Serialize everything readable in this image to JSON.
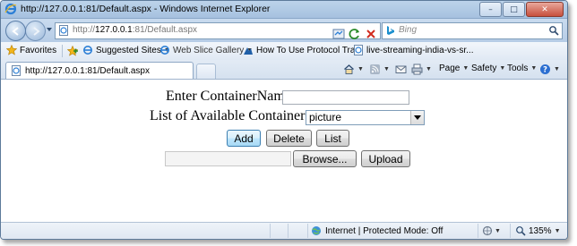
{
  "window": {
    "title": "http://127.0.0.1:81/Default.aspx - Windows Internet Explorer",
    "controls": {
      "minimize": "–",
      "maximize": "□",
      "close": "✕"
    }
  },
  "address_bar": {
    "url_prefix": "http://",
    "url_host": "127.0.0.1",
    "url_rest": ":81/Default.aspx"
  },
  "search": {
    "placeholder": "Bing"
  },
  "favorites_bar": {
    "favorites_label": "Favorites",
    "items": [
      {
        "label": "Suggested Sites",
        "has_dropdown": true
      },
      {
        "label": "Web Slice Gallery",
        "has_dropdown": true
      },
      {
        "label": "How To Use Protocol Tra...",
        "has_dropdown": false
      },
      {
        "label": "live-streaming-india-vs-sr...",
        "has_dropdown": false
      }
    ]
  },
  "tabs": [
    {
      "label": "http://127.0.0.1:81/Default.aspx",
      "active": true
    }
  ],
  "command_bar": {
    "page": "Page",
    "safety": "Safety",
    "tools": "Tools"
  },
  "form": {
    "container_name_label": "Enter ContainerName",
    "container_name_value": "",
    "available_label": "List of Available Containers :",
    "available_selected": "picture",
    "add_button": "Add",
    "delete_button": "Delete",
    "list_button": "List",
    "browse_button": "Browse...",
    "upload_button": "Upload",
    "file_path_value": ""
  },
  "status_bar": {
    "zone": "Internet | Protected Mode: Off",
    "zoom": "135%"
  },
  "colors": {
    "chrome_blue": "#b6cce6",
    "ie_logo": "#2c7fd6",
    "close_red": "#c7503d"
  }
}
